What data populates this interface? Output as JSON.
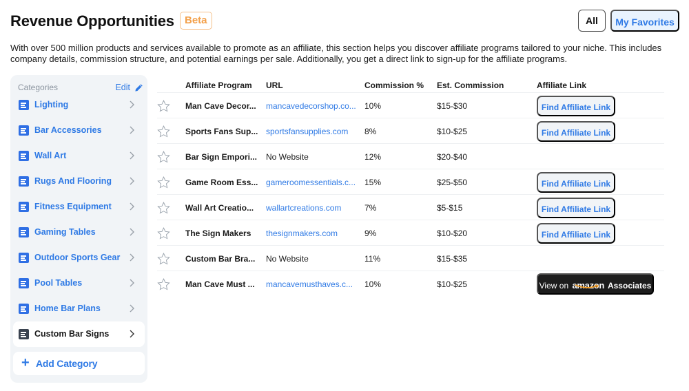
{
  "header": {
    "title": "Revenue Opportunities",
    "badge": "Beta",
    "filters": {
      "all": "All",
      "favorites": "My Favorites"
    },
    "description": "With over 500 million products and services available to promote as an affiliate, this section helps you discover affiliate programs tailored to your niche. This includes company details, commission structure, and potential earnings per sale. Additionally, you get a direct link to sign-up for the affiliate programs."
  },
  "sidebar": {
    "heading": "Categories",
    "edit_label": "Edit",
    "items": [
      {
        "label": "Lighting",
        "active": false
      },
      {
        "label": "Bar Accessories",
        "active": false
      },
      {
        "label": "Wall Art",
        "active": false
      },
      {
        "label": "Rugs And Flooring",
        "active": false
      },
      {
        "label": "Fitness Equipment",
        "active": false
      },
      {
        "label": "Gaming Tables",
        "active": false
      },
      {
        "label": "Outdoor Sports Gear",
        "active": false
      },
      {
        "label": "Pool Tables",
        "active": false
      },
      {
        "label": "Home Bar Plans",
        "active": false
      },
      {
        "label": "Custom Bar Signs",
        "active": true
      }
    ],
    "add_label": "Add Category"
  },
  "table": {
    "columns": [
      "Affiliate Program",
      "URL",
      "Commission %",
      "Est. Commission",
      "Affiliate Link"
    ],
    "rows": [
      {
        "program": "Man Cave Decor...",
        "url": "mancavedecorshop.co...",
        "has_url": true,
        "commission": "10%",
        "est": "$15-$30",
        "link": "find"
      },
      {
        "program": "Sports Fans Sup...",
        "url": "sportsfansupplies.com",
        "has_url": true,
        "commission": "8%",
        "est": "$10-$25",
        "link": "find"
      },
      {
        "program": "Bar Sign Empori...",
        "url": "No Website",
        "has_url": false,
        "commission": "12%",
        "est": "$20-$40",
        "link": "none"
      },
      {
        "program": "Game Room Ess...",
        "url": "gameroomessentials.c...",
        "has_url": true,
        "commission": "15%",
        "est": "$25-$50",
        "link": "find"
      },
      {
        "program": "Wall Art Creatio...",
        "url": "wallartcreations.com",
        "has_url": true,
        "commission": "7%",
        "est": "$5-$15",
        "link": "find"
      },
      {
        "program": "The Sign Makers",
        "url": "thesignmakers.com",
        "has_url": true,
        "commission": "9%",
        "est": "$10-$20",
        "link": "find"
      },
      {
        "program": "Custom Bar Bra...",
        "url": "No Website",
        "has_url": false,
        "commission": "11%",
        "est": "$15-$35",
        "link": "none"
      },
      {
        "program": "Man Cave Must ...",
        "url": "mancavemusthaves.c...",
        "has_url": true,
        "commission": "10%",
        "est": "$10-$25",
        "link": "amazon"
      }
    ],
    "find_link_label": "Find Affiliate Link",
    "amazon_button": {
      "prefix": "View on",
      "brand": "amazon",
      "suffix": "Associates"
    }
  },
  "colors": {
    "accent": "#2f7ae5",
    "beta": "#f3a04a",
    "sidebar_bg": "#f1f4f7",
    "amazon_btn_bg": "#1d1d1d",
    "amazon_smile": "#f39a1d"
  }
}
